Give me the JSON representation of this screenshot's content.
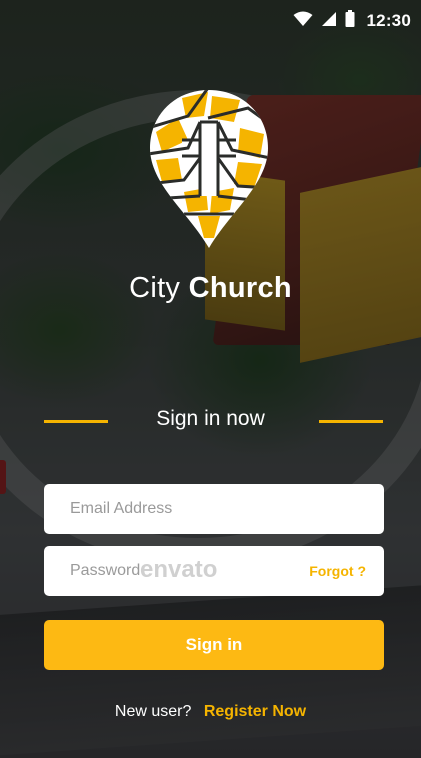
{
  "status_bar": {
    "time": "12:30",
    "icons": [
      "wifi-icon",
      "cellular-signal-icon",
      "battery-icon"
    ]
  },
  "brand": {
    "name_regular": "City",
    "name_bold": "Church",
    "logo": "city-church-map-pin-cross-logo",
    "accent_color": "#f5b400"
  },
  "heading": "Sign in now",
  "form": {
    "email_placeholder": "Email Address",
    "password_placeholder": "Password",
    "forgot_label": "Forgot ?",
    "signin_label": "Sign in"
  },
  "footer": {
    "question": "New user?",
    "register_label": "Register Now"
  },
  "watermark": "envato"
}
